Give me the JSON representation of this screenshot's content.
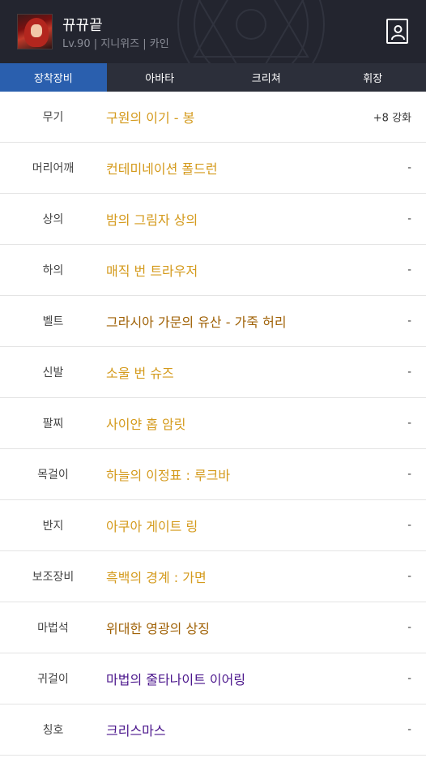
{
  "header": {
    "character_name": "뀨뀨끝",
    "character_info": "Lv.90 | 지니위즈 | 카인",
    "avatar_icon": "character-portrait",
    "profile_icon": "profile-card-icon",
    "background_color": "#23252f"
  },
  "tabs": [
    {
      "label": "장착장비",
      "active": true
    },
    {
      "label": "아바타",
      "active": false
    },
    {
      "label": "크리쳐",
      "active": false
    },
    {
      "label": "휘장",
      "active": false
    }
  ],
  "colors": {
    "tab_active": "#2a5fae",
    "epic": "#d49a1c",
    "legendary": "#a06207",
    "unique": "#4b168c"
  },
  "equipment": [
    {
      "slot": "무기",
      "name": "구원의 이기 - 봉",
      "extra": "+8 강화",
      "color": "#d49a1c"
    },
    {
      "slot": "머리어깨",
      "name": "컨테미네이션 폴드런",
      "extra": "-",
      "color": "#d49a1c"
    },
    {
      "slot": "상의",
      "name": "밤의 그림자 상의",
      "extra": "-",
      "color": "#d49a1c"
    },
    {
      "slot": "하의",
      "name": "매직 번 트라우저",
      "extra": "-",
      "color": "#d49a1c"
    },
    {
      "slot": "벨트",
      "name": "그라시아 가문의 유산 - 가죽 허리",
      "extra": "-",
      "color": "#a06207"
    },
    {
      "slot": "신발",
      "name": "소울 번 슈즈",
      "extra": "-",
      "color": "#d49a1c"
    },
    {
      "slot": "팔찌",
      "name": "사이얀 홉 암릿",
      "extra": "-",
      "color": "#d49a1c"
    },
    {
      "slot": "목걸이",
      "name": "하늘의 이정표 : 루크바",
      "extra": "-",
      "color": "#d49a1c"
    },
    {
      "slot": "반지",
      "name": "아쿠아 게이트 링",
      "extra": "-",
      "color": "#d49a1c"
    },
    {
      "slot": "보조장비",
      "name": "흑백의 경계 : 가면",
      "extra": "-",
      "color": "#d49a1c"
    },
    {
      "slot": "마법석",
      "name": "위대한 영광의 상징",
      "extra": "-",
      "color": "#a06207"
    },
    {
      "slot": "귀걸이",
      "name": "마법의 줄타나이트 이어링",
      "extra": "-",
      "color": "#4b168c"
    },
    {
      "slot": "칭호",
      "name": "크리스마스",
      "extra": "-",
      "color": "#4b168c"
    }
  ]
}
